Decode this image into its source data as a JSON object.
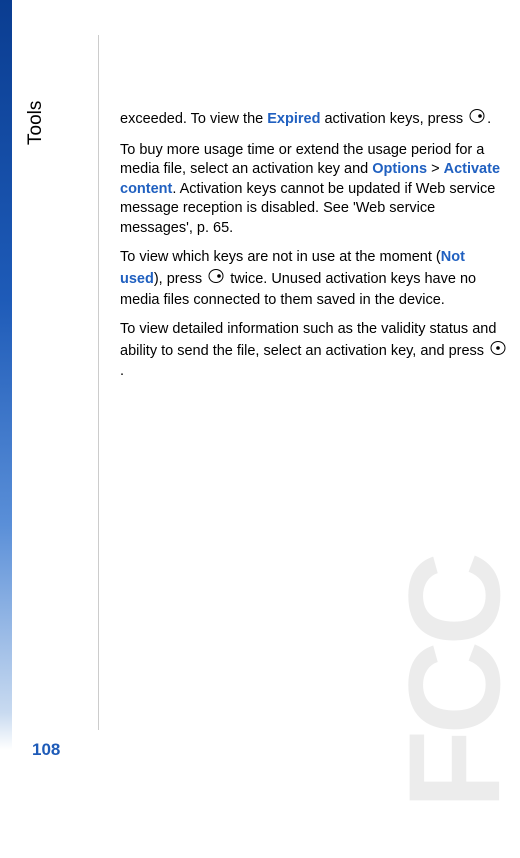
{
  "sidebar": {
    "section_label": "Tools",
    "page_number": "108"
  },
  "content": {
    "p1": {
      "text1": "exceeded. To view the ",
      "highlight1": "Expired",
      "text2": " activation keys, press ",
      "text3": "."
    },
    "p2": {
      "text1": "To buy more usage time or extend the usage period for a media file, select an activation key and ",
      "highlight1": "Options",
      "text2": " > ",
      "highlight2": "Activate content",
      "text3": ". Activation keys cannot be updated if Web service message reception is disabled. See 'Web service messages', p. 65."
    },
    "p3": {
      "text1": "To view which keys are not in use at the moment (",
      "highlight1": "Not used",
      "text2": "), press ",
      "text3": " twice. Unused activation keys have no media files connected to them saved in the device."
    },
    "p4": {
      "text1": "To view detailed information such as the validity status and ability to send the file, select an activation key, and press ",
      "text2": "."
    }
  },
  "watermark": "FCC"
}
